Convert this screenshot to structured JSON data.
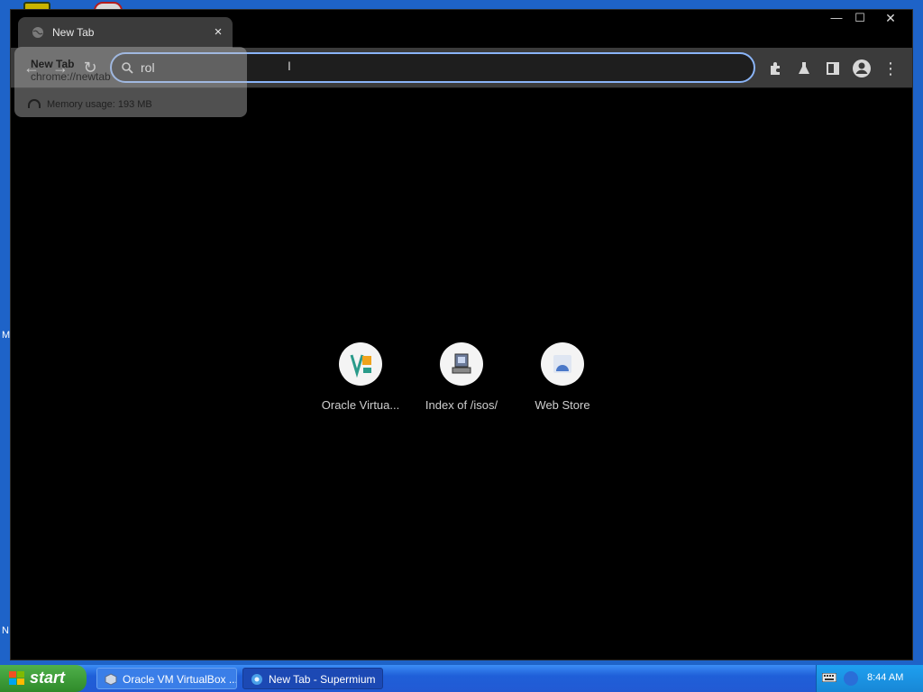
{
  "desktop": {
    "edge_letters": [
      "M",
      "N"
    ]
  },
  "tab": {
    "title": "New Tab",
    "close_glyph": "×"
  },
  "window_controls": {
    "minimize": "—",
    "maximize": "☐",
    "close": "✕"
  },
  "toolbar": {
    "back_glyph": "←",
    "forward_glyph": "→",
    "reload_glyph": "↻",
    "omnibox_text": "rol",
    "menu_glyph": "⋮",
    "icons": [
      "puzzle-icon",
      "flask-icon",
      "side-panel-icon",
      "profile-icon",
      "menu-icon"
    ]
  },
  "hover_card": {
    "title": "New Tab",
    "url": "chrome://newtab",
    "memory": "Memory usage: 193 MB"
  },
  "shortcuts": [
    {
      "label": "Oracle Virtua..."
    },
    {
      "label": "Index of /isos/"
    },
    {
      "label": "Web Store"
    }
  ],
  "taskbar": {
    "start_label": "start",
    "tasks": [
      {
        "label": "Oracle VM VirtualBox ..."
      },
      {
        "label": "New Tab - Supermium"
      }
    ],
    "clock": "8:44 AM"
  },
  "colors": {
    "accent": "#8ab4f8",
    "toolbar": "#3b3b3b",
    "page_bg": "#000000",
    "taskbar": "#225ad4",
    "start": "#2f8a2a"
  }
}
